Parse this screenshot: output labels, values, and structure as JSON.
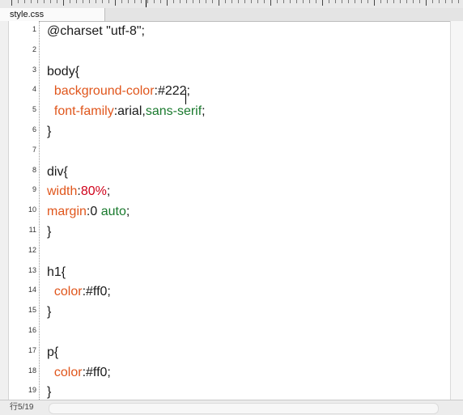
{
  "tab": {
    "label": "style.css"
  },
  "editor": {
    "lines": [
      {
        "num": "1",
        "segments": [
          {
            "text": "@charset \"utf-8\";",
            "style": "plain"
          }
        ]
      },
      {
        "num": "2",
        "segments": []
      },
      {
        "num": "3",
        "segments": [
          {
            "text": "body{",
            "style": "plain"
          }
        ]
      },
      {
        "num": "4",
        "segments": [
          {
            "text": "  ",
            "style": "plain"
          },
          {
            "text": "background-color",
            "style": "prop"
          },
          {
            "text": ":#222;",
            "style": "plain"
          }
        ]
      },
      {
        "num": "5",
        "segments": [
          {
            "text": "  ",
            "style": "plain"
          },
          {
            "text": "font-family",
            "style": "prop"
          },
          {
            "text": ":arial,",
            "style": "plain"
          },
          {
            "text": "sans-serif",
            "style": "kw"
          },
          {
            "text": ";",
            "style": "plain"
          }
        ]
      },
      {
        "num": "6",
        "segments": [
          {
            "text": "}",
            "style": "plain"
          }
        ]
      },
      {
        "num": "7",
        "segments": []
      },
      {
        "num": "8",
        "segments": [
          {
            "text": "div{",
            "style": "plain"
          }
        ]
      },
      {
        "num": "9",
        "segments": [
          {
            "text": "width",
            "style": "prop"
          },
          {
            "text": ":",
            "style": "plain"
          },
          {
            "text": "80%",
            "style": "red"
          },
          {
            "text": ";",
            "style": "plain"
          }
        ]
      },
      {
        "num": "10",
        "segments": [
          {
            "text": "margin",
            "style": "prop"
          },
          {
            "text": ":0 ",
            "style": "plain"
          },
          {
            "text": "auto",
            "style": "kw"
          },
          {
            "text": ";",
            "style": "plain"
          }
        ]
      },
      {
        "num": "11",
        "segments": [
          {
            "text": "}",
            "style": "plain"
          }
        ]
      },
      {
        "num": "12",
        "segments": []
      },
      {
        "num": "13",
        "segments": [
          {
            "text": "h1{",
            "style": "plain"
          }
        ]
      },
      {
        "num": "14",
        "segments": [
          {
            "text": "  ",
            "style": "plain"
          },
          {
            "text": "color",
            "style": "prop"
          },
          {
            "text": ":#ff0;",
            "style": "plain"
          }
        ]
      },
      {
        "num": "15",
        "segments": [
          {
            "text": "}",
            "style": "plain"
          }
        ]
      },
      {
        "num": "16",
        "segments": []
      },
      {
        "num": "17",
        "segments": [
          {
            "text": "p{",
            "style": "plain"
          }
        ]
      },
      {
        "num": "18",
        "segments": [
          {
            "text": "  ",
            "style": "plain"
          },
          {
            "text": "color",
            "style": "prop"
          },
          {
            "text": ":#ff0;",
            "style": "plain"
          }
        ]
      },
      {
        "num": "19",
        "segments": [
          {
            "text": "}",
            "style": "plain"
          }
        ]
      }
    ]
  },
  "status": {
    "position": "行5/19"
  },
  "colors": {
    "property": "#e0561c",
    "value_red": "#d0021b",
    "keyword": "#1a7a2e"
  }
}
